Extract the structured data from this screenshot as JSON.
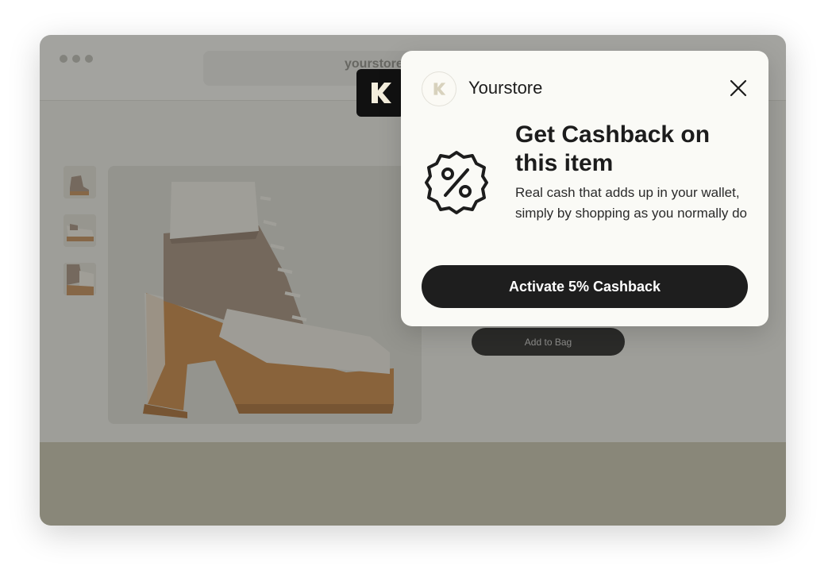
{
  "browser": {
    "url": "yourstore"
  },
  "product": {
    "add_to_bag_label": "Add to Bag"
  },
  "popup": {
    "brand_name": "Yourstore",
    "headline": "Get Cashback on this item",
    "subtext": "Real cash that adds up in your wallet, simply by shopping as you normally do",
    "cta_label": "Activate 5% Cashback"
  },
  "icons": {
    "badge": "k-logo-icon",
    "brand": "k-logo-icon",
    "close": "close-icon",
    "offer": "percent-badge-icon"
  },
  "colors": {
    "dark": "#1e1e1e",
    "popup_bg": "#fafaf6",
    "footer": "#c9c5b0"
  }
}
